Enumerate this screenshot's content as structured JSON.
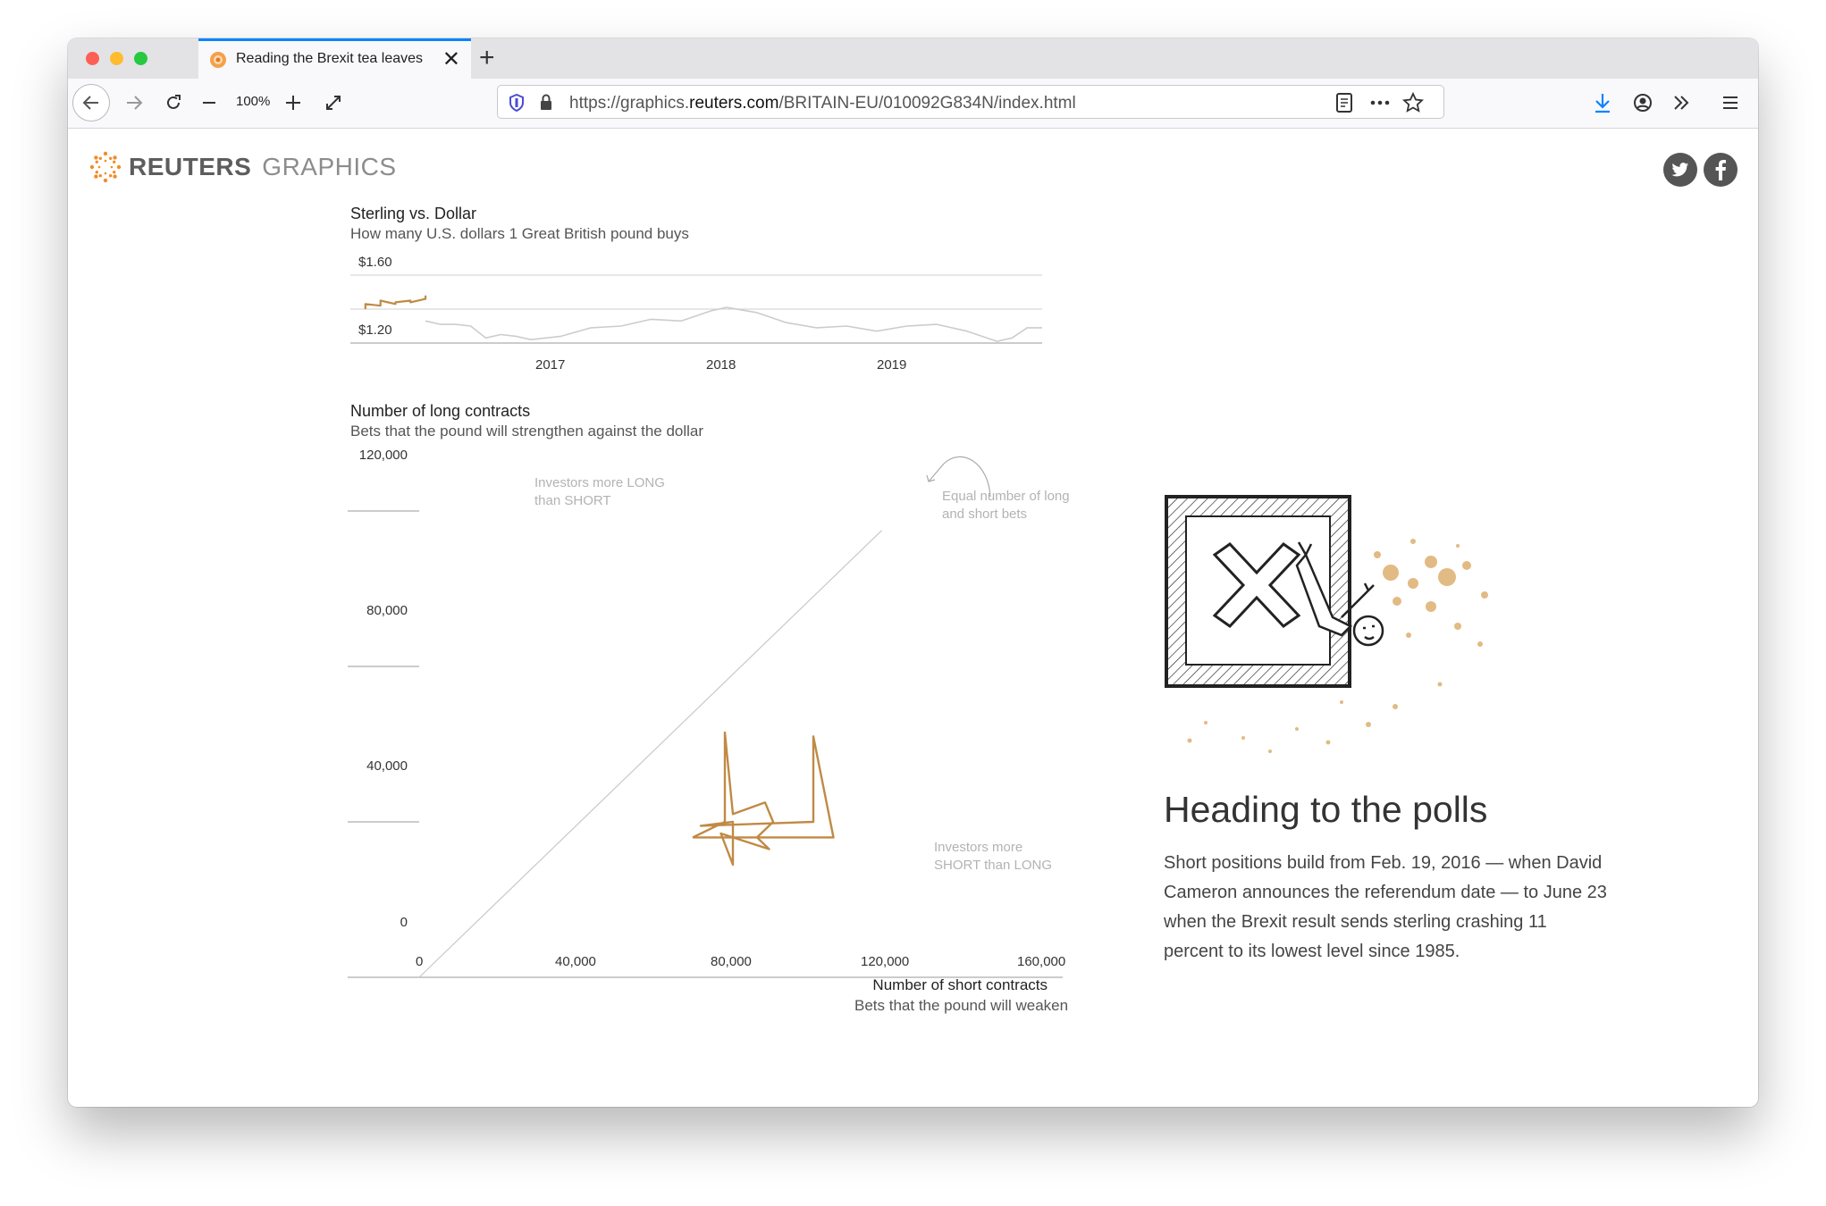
{
  "browser": {
    "tab_title": "Reading the Brexit tea leaves",
    "tab_close": "✕",
    "new_tab": "+",
    "zoom": "100%",
    "url_prefix": "https://graphics.",
    "url_domain": "reuters.com",
    "url_path": "/BRITAIN-EU/010092G834N/index.html"
  },
  "header": {
    "brand_primary": "REUTERS",
    "brand_secondary": "GRAPHICS"
  },
  "chart_data": [
    {
      "type": "line",
      "title": "Sterling vs. Dollar",
      "subtitle": "How many U.S. dollars 1 Great British pound buys",
      "ylabel_ticks": [
        "$1.60",
        "$1.20"
      ],
      "y_ticks": [
        1.6,
        1.4,
        1.2
      ],
      "ylim": [
        1.2,
        1.6
      ],
      "x_ticks": [
        "2017",
        "2018",
        "2019"
      ],
      "x_range": [
        "2016-01",
        "2019-11"
      ],
      "grid": true,
      "series": [
        {
          "color": "#c08a45",
          "x": [
            "2016-02",
            "2016-02",
            "2016-03",
            "2016-03",
            "2016-04",
            "2016-04",
            "2016-05",
            "2016-05",
            "2016-06",
            "2016-06"
          ],
          "y": [
            1.4,
            1.43,
            1.42,
            1.45,
            1.43,
            1.44,
            1.45,
            1.44,
            1.46,
            1.48
          ]
        },
        {
          "color": "#cccccc",
          "x": [
            "2016-06",
            "2016-07",
            "2016-08",
            "2016-09",
            "2016-10",
            "2016-11",
            "2016-12",
            "2017-01",
            "2017-03",
            "2017-05",
            "2017-07",
            "2017-09",
            "2017-11",
            "2018-01",
            "2018-02",
            "2018-04",
            "2018-06",
            "2018-08",
            "2018-10",
            "2018-12",
            "2019-02",
            "2019-04",
            "2019-06",
            "2019-08",
            "2019-09",
            "2019-10",
            "2019-11"
          ],
          "y": [
            1.33,
            1.31,
            1.31,
            1.3,
            1.23,
            1.25,
            1.24,
            1.22,
            1.24,
            1.29,
            1.3,
            1.34,
            1.33,
            1.39,
            1.41,
            1.38,
            1.32,
            1.29,
            1.3,
            1.27,
            1.3,
            1.31,
            1.27,
            1.21,
            1.23,
            1.29,
            1.29
          ]
        }
      ]
    },
    {
      "type": "line",
      "title": "Number of long contracts",
      "subtitle": "Bets that the pound will strengthen against the dollar",
      "xlabel": "Number of short contracts",
      "xlabel_sub": "Bets that the pound will weaken",
      "x_ticks": [
        "0",
        "40,000",
        "80,000",
        "120,000",
        "160,000"
      ],
      "y_ticks": [
        "120,000",
        "80,000",
        "40,000",
        "0"
      ],
      "xlim": [
        0,
        160000
      ],
      "ylim": [
        0,
        120000
      ],
      "annotations": [
        "Investors more LONG than SHORT",
        "Equal number of long and short bets",
        "Investors more SHORT than LONG"
      ],
      "series": [
        {
          "color": "#c08a45",
          "points": [
            [
              68000,
              36000
            ],
            [
              76000,
              40000
            ],
            [
              76000,
              63000
            ],
            [
              78000,
              42000
            ],
            [
              86000,
              45000
            ],
            [
              88000,
              40000
            ],
            [
              84000,
              36000
            ],
            [
              87000,
              33000
            ],
            [
              75000,
              37000
            ],
            [
              78000,
              29000
            ],
            [
              78000,
              40000
            ],
            [
              70000,
              39000
            ],
            [
              98000,
              40000
            ],
            [
              98000,
              62000
            ],
            [
              103000,
              36000
            ],
            [
              76000,
              36000
            ],
            [
              68000,
              36000
            ]
          ]
        },
        {
          "color": "#c8c8c8",
          "points": [
            [
              0,
              0
            ],
            [
              115000,
              115000
            ]
          ]
        }
      ]
    }
  ],
  "article": {
    "heading": "Heading to the polls",
    "body": "Short positions build from Feb. 19, 2016 — when David Cameron announces the referendum date — to June 23 when the Brexit result sends sterling crashing 11 percent to its lowest level since 1985."
  },
  "colors": {
    "accent": "#c08a45",
    "secondary_line": "#cccccc",
    "tab_highlight": "#0a84ff",
    "brand_orange": "#f28c28"
  }
}
